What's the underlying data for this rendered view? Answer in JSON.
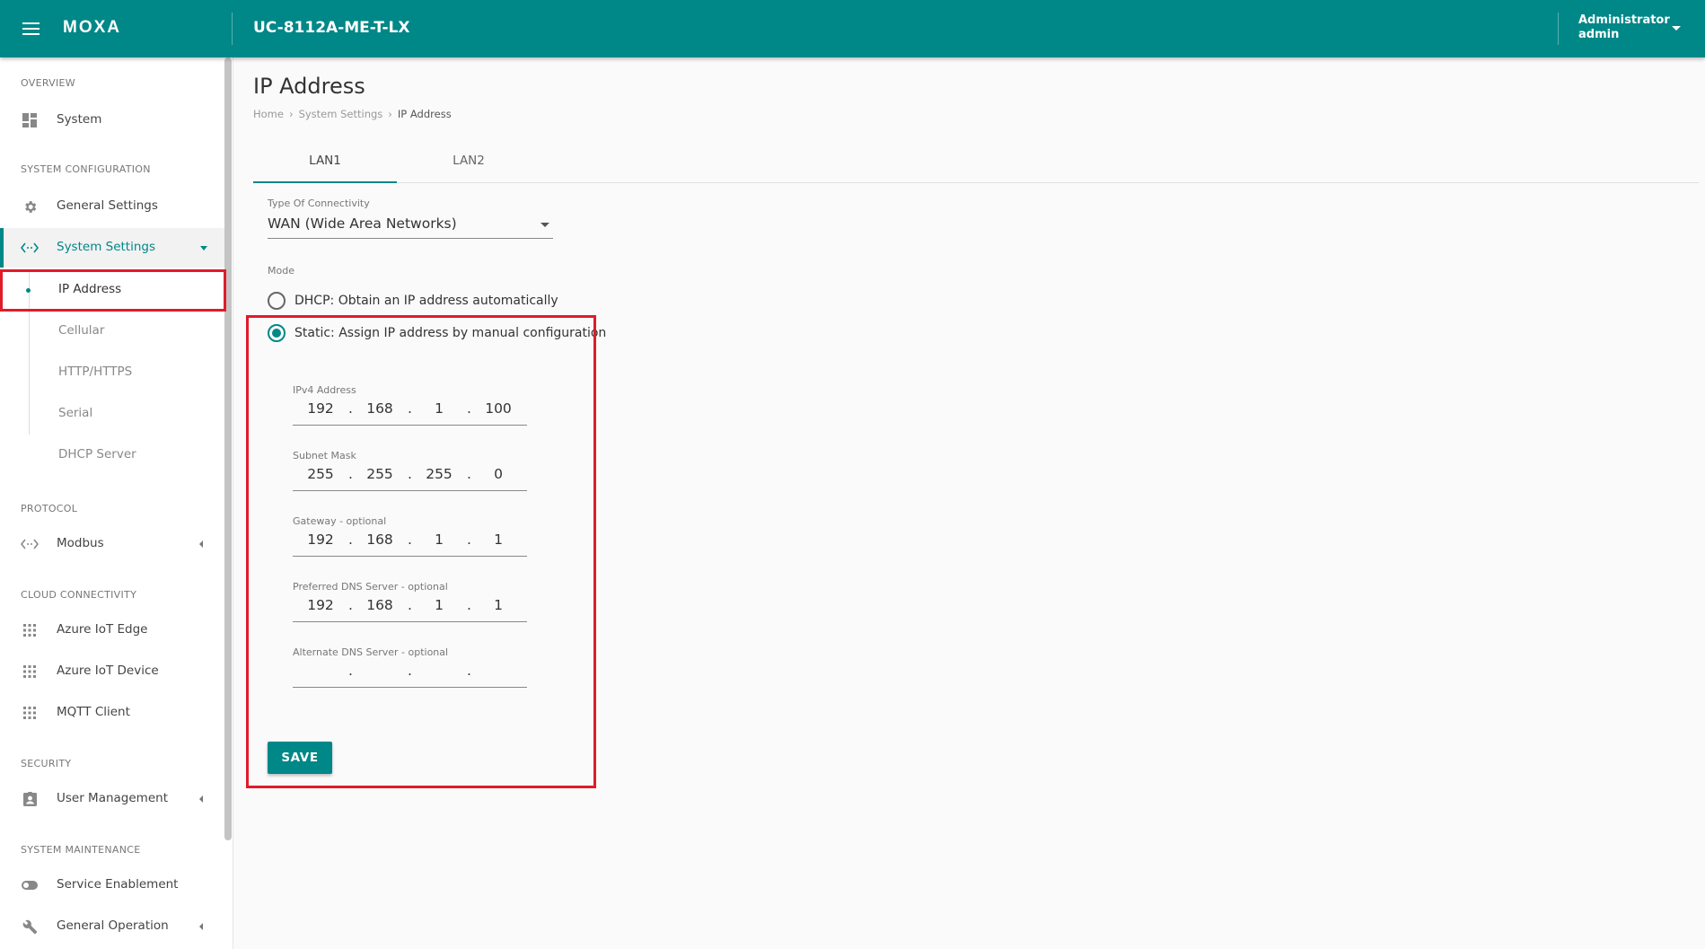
{
  "header": {
    "brand": "MOXA",
    "device_name": "UC-8112A-ME-T-LX",
    "user_role": "Administrator",
    "user_name": "admin"
  },
  "sidebar": {
    "sections": {
      "overview": "OVERVIEW",
      "system_configuration": "SYSTEM CONFIGURATION",
      "protocol": "PROTOCOL",
      "cloud_connectivity": "CLOUD CONNECTIVITY",
      "security": "SECURITY",
      "system_maintenance": "SYSTEM MAINTENANCE"
    },
    "items": {
      "system": "System",
      "general_settings": "General Settings",
      "system_settings": "System Settings",
      "modbus": "Modbus",
      "azure_iot_edge": "Azure IoT Edge",
      "azure_iot_device": "Azure IoT Device",
      "mqtt_client": "MQTT Client",
      "user_management": "User Management",
      "service_enablement": "Service Enablement",
      "general_operation": "General Operation"
    },
    "sub_items": {
      "ip_address": "IP Address",
      "cellular": "Cellular",
      "http_https": "HTTP/HTTPS",
      "serial": "Serial",
      "dhcp_server": "DHCP Server"
    }
  },
  "main": {
    "title": "IP Address",
    "breadcrumb": [
      "Home",
      "System Settings",
      "IP Address"
    ],
    "tabs": [
      "LAN1",
      "LAN2"
    ],
    "connectivity": {
      "label": "Type Of Connectivity",
      "value": "WAN (Wide Area Networks)"
    },
    "mode": {
      "label": "Mode",
      "dhcp_label": "DHCP: Obtain an IP address automatically",
      "static_label": "Static: Assign IP address by manual configuration",
      "selected": "static"
    },
    "fields": {
      "ipv4": {
        "label": "IPv4 Address",
        "octets": [
          "192",
          "168",
          "1",
          "100"
        ]
      },
      "subnet": {
        "label": "Subnet Mask",
        "octets": [
          "255",
          "255",
          "255",
          "0"
        ]
      },
      "gateway": {
        "label": "Gateway - optional",
        "octets": [
          "192",
          "168",
          "1",
          "1"
        ]
      },
      "dns_preferred": {
        "label": "Preferred DNS Server - optional",
        "octets": [
          "192",
          "168",
          "1",
          "1"
        ]
      },
      "dns_alternate": {
        "label": "Alternate DNS Server - optional",
        "octets": [
          "",
          "",
          "",
          ""
        ]
      }
    },
    "save_label": "SAVE"
  },
  "colors": {
    "brand_teal": "#008787",
    "highlight_red": "#e01b2a"
  }
}
